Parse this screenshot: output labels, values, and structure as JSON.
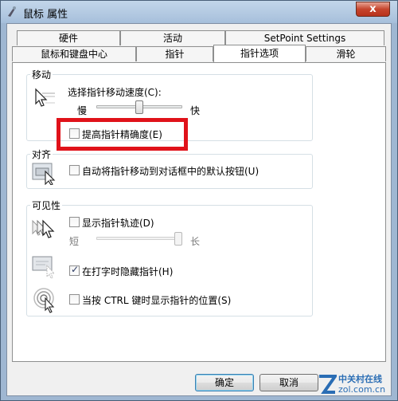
{
  "window": {
    "title": "鼠标 属性",
    "close_glyph": "x"
  },
  "tabs_row1": [
    {
      "label": "硬件"
    },
    {
      "label": "活动"
    },
    {
      "label": "SetPoint Settings"
    }
  ],
  "tabs_row2": [
    {
      "label": "鼠标和键盘中心"
    },
    {
      "label": "指针"
    },
    {
      "label": "指针选项"
    },
    {
      "label": "滑轮"
    }
  ],
  "motion": {
    "group_label": "移动",
    "speed_label": "选择指针移动速度(C):",
    "slow_label": "慢",
    "fast_label": "快",
    "speed_fraction": 0.5,
    "precision_label": "提高指针精确度(E)",
    "precision_checked": false
  },
  "snap": {
    "group_label": "对齐",
    "snap_label": "自动将指针移动到对话框中的默认按钮(U)",
    "snap_checked": false
  },
  "visibility": {
    "group_label": "可见性",
    "trails_label": "显示指针轨迹(D)",
    "trails_checked": false,
    "short_label": "短",
    "long_label": "长",
    "trails_fraction": 1.0,
    "hide_label": "在打字时隐藏指针(H)",
    "hide_checked": true,
    "ctrl_label": "当按 CTRL 键时显示指针的位置(S)",
    "ctrl_checked": false
  },
  "buttons": {
    "ok": "确定",
    "cancel": "取消"
  },
  "watermark": {
    "brand_text": "中关村在线",
    "brand_url": "zol.com.cn"
  }
}
